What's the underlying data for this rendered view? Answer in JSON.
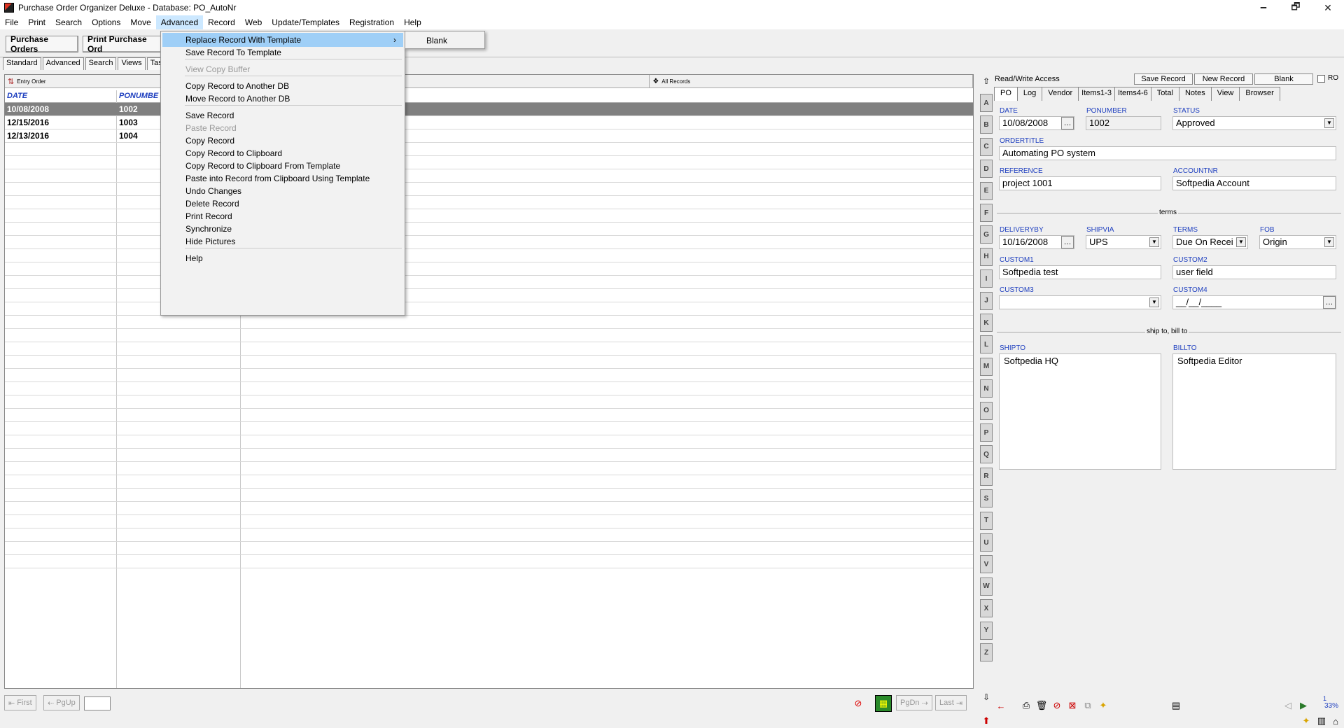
{
  "window": {
    "title": "Purchase Order Organizer Deluxe - Database: PO_AutoNr",
    "minimize": "🗕",
    "restore": "🗗",
    "close": "✕"
  },
  "menubar": [
    "File",
    "Print",
    "Search",
    "Options",
    "Move",
    "Advanced",
    "Record",
    "Web",
    "Update/Templates",
    "Registration",
    "Help"
  ],
  "toolbar": {
    "purchase_orders": "Purchase Orders",
    "print_purchase_orders": "Print Purchase Ord"
  },
  "view_tabs": [
    "Standard",
    "Advanced",
    "Search",
    "Views",
    "Tas"
  ],
  "list_bar": {
    "entry_order": "Entry Order",
    "all_records": "All Records"
  },
  "grid": {
    "columns": [
      "DATE",
      "PONUMBE"
    ],
    "rows": [
      {
        "date": "10/08/2008",
        "po": "1002"
      },
      {
        "date": "12/15/2016",
        "po": "1003"
      },
      {
        "date": "12/13/2016",
        "po": "1004"
      }
    ]
  },
  "nav": {
    "first": "First",
    "pgup": "PgUp",
    "pgdn": "PgDn",
    "last": "Last",
    "record_input": ""
  },
  "alphabet": [
    "A",
    "B",
    "C",
    "D",
    "E",
    "F",
    "G",
    "H",
    "I",
    "J",
    "K",
    "L",
    "M",
    "N",
    "O",
    "P",
    "Q",
    "R",
    "S",
    "T",
    "U",
    "V",
    "W",
    "X",
    "Y",
    "Z"
  ],
  "rpanel": {
    "access": "Read/Write Access",
    "save_record": "Save Record",
    "new_record": "New Record",
    "blank": "Blank",
    "ro": "RO",
    "tabs": [
      "PO",
      "Log",
      "Vendor",
      "Items1-3",
      "Items4-6",
      "Total",
      "Notes",
      "View",
      "Browser"
    ],
    "labels": {
      "date": "DATE",
      "ponumber": "PONUMBER",
      "status": "STATUS",
      "ordertitle": "ORDERTITLE",
      "reference": "REFERENCE",
      "accountnr": "ACCOUNTNR",
      "terms_sep": "terms",
      "deliveryby": "DELIVERYBY",
      "shipvia": "SHIPVIA",
      "terms": "TERMS",
      "fob": "FOB",
      "custom1": "CUSTOM1",
      "custom2": "CUSTOM2",
      "custom3": "CUSTOM3",
      "custom4": "CUSTOM4",
      "ship_sep": "ship to, bill to",
      "shipto": "SHIPTO",
      "billto": "BILLTO"
    },
    "values": {
      "date": "10/08/2008",
      "ponumber": "1002",
      "status": "Approved",
      "ordertitle": "Automating PO system",
      "reference": "project 1001",
      "accountnr": "Softpedia Account",
      "deliveryby": "10/16/2008",
      "shipvia": "UPS",
      "terms": "Due On Recei",
      "fob": "Origin",
      "custom1": "Softpedia test",
      "custom2": "user field",
      "custom3": "",
      "custom4": "__/__/____",
      "shipto": "Softpedia HQ",
      "billto": "Softpedia Editor"
    },
    "zoom": "33%",
    "zoom_top": "1"
  },
  "menu": {
    "items": [
      "Replace Record With Template",
      "Save Record To Template",
      "View Copy Buffer",
      "Copy Record to Another DB",
      "Move Record to Another DB",
      "Save Record",
      "Paste Record",
      "Copy Record",
      "Copy Record to Clipboard",
      "Copy Record to Clipboard From Template",
      "Paste into Record from Clipboard Using Template",
      "Undo Changes",
      "Delete Record",
      "Print Record",
      "Synchronize",
      "Hide Pictures",
      "Help"
    ],
    "submenu_arrow": "›",
    "submenu": [
      "Blank"
    ]
  }
}
